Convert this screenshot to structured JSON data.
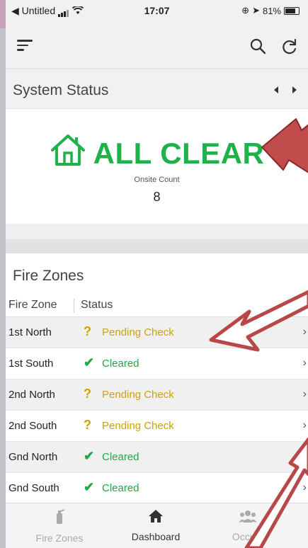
{
  "statusbar": {
    "back_app": "◀ Untitled",
    "time": "17:07",
    "battery_pct": "81%"
  },
  "header": {
    "menu_icon": "hamburger-icon",
    "search_icon": "search-icon",
    "refresh_icon": "refresh-icon"
  },
  "system_status": {
    "title": "System Status",
    "state": "ALL CLEAR",
    "state_color": "#1fb24a",
    "onsite_label": "Onsite Count",
    "onsite_count": "8"
  },
  "fire_zones": {
    "title": "Fire Zones",
    "col_zone": "Fire Zone",
    "col_status": "Status",
    "rows": [
      {
        "zone": "1st North",
        "status": "Pending Check",
        "icon": "?",
        "kind": "pending"
      },
      {
        "zone": "1st South",
        "status": "Cleared",
        "icon": "✔",
        "kind": "cleared"
      },
      {
        "zone": "2nd North",
        "status": "Pending Check",
        "icon": "?",
        "kind": "pending"
      },
      {
        "zone": "2nd South",
        "status": "Pending Check",
        "icon": "?",
        "kind": "pending"
      },
      {
        "zone": "Gnd North",
        "status": "Cleared",
        "icon": "✔",
        "kind": "cleared"
      },
      {
        "zone": "Gnd South",
        "status": "Cleared",
        "icon": "✔",
        "kind": "cleared"
      }
    ],
    "pending_color": "#c9a400",
    "cleared_color": "#1fa843"
  },
  "bottom_nav": {
    "fire_zones": "Fire Zones",
    "dashboard": "Dashboard",
    "occupants": "Occu..."
  }
}
